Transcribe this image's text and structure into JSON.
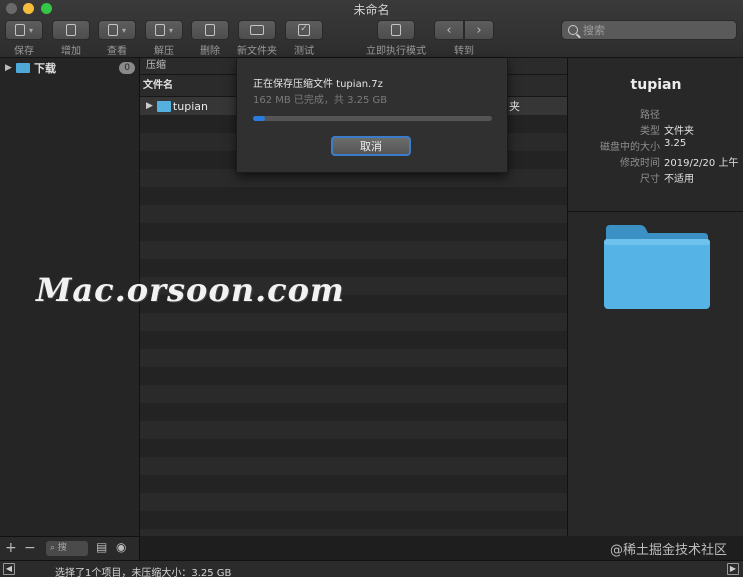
{
  "window": {
    "title": "未命名"
  },
  "toolbar": {
    "save": "保存",
    "add": "增加",
    "view": "查看",
    "extract": "解压",
    "delete": "删除",
    "new_folder": "新文件夹",
    "test": "测试",
    "instant_mode": "立即执行模式",
    "goto": "转到",
    "search_placeholder": "搜索"
  },
  "sidebar": {
    "items": [
      {
        "label": "下载",
        "badge": "0"
      }
    ]
  },
  "list": {
    "path": "压缩",
    "column_name": "文件名",
    "rows": [
      {
        "name": "tupian",
        "kind": "夹"
      }
    ]
  },
  "progress_sheet": {
    "title": "正在保存压缩文件 tupian.7z",
    "subtitle": "162 MB 已完成，共 3.25 GB",
    "progress": 0.05,
    "cancel_label": "取消"
  },
  "info_panel": {
    "title": "tupian",
    "rows": [
      {
        "key": "路径",
        "value": ""
      },
      {
        "key": "类型",
        "value": "文件夹"
      },
      {
        "key": "磁盘中的大小",
        "value": "3.25"
      },
      {
        "key": "修改时间",
        "value": "2019/2/20 上午"
      },
      {
        "key": "尺寸",
        "value": "不适用"
      }
    ]
  },
  "bottom": {
    "add": "+",
    "remove": "−",
    "mini_search": "搜",
    "status": "选择了1个项目，未压缩大小：3.25 GB"
  },
  "watermark": {
    "main": "Mac.orsoon.com",
    "corner": "@稀土掘金技术社区"
  },
  "colors": {
    "accent": "#2a7de0",
    "folder": "#4ea9d9"
  }
}
